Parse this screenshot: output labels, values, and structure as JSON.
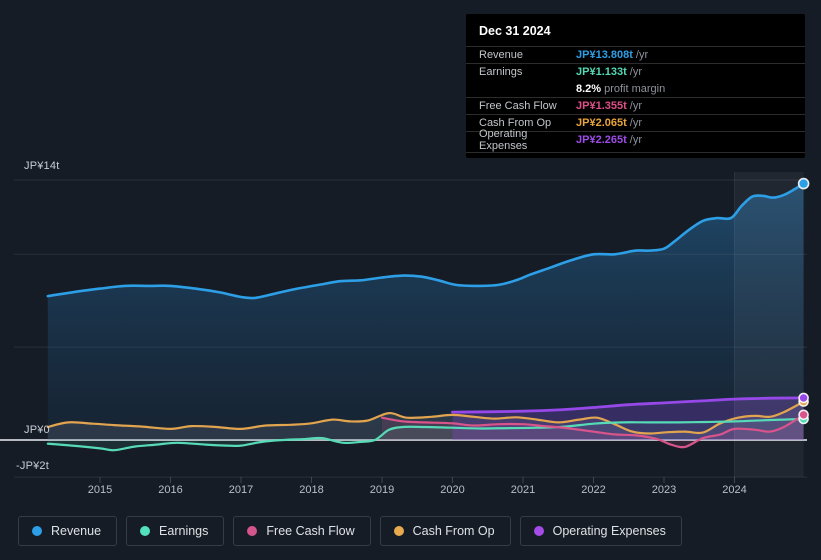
{
  "tooltip": {
    "title": "Dec 31 2024",
    "rows": [
      {
        "label": "Revenue",
        "value": "JP¥13.808t",
        "suffix": "/yr",
        "color": "#2d9fe6"
      },
      {
        "label": "Earnings",
        "value": "JP¥1.133t",
        "suffix": "/yr",
        "color": "#55d8b4",
        "margin_value": "8.2%",
        "margin_label": "profit margin"
      },
      {
        "label": "Free Cash Flow",
        "value": "JP¥1.355t",
        "suffix": "/yr",
        "color": "#dd5088"
      },
      {
        "label": "Cash From Op",
        "value": "JP¥2.065t",
        "suffix": "/yr",
        "color": "#e8a43d"
      },
      {
        "label": "Operating Expenses",
        "value": "JP¥2.265t",
        "suffix": "/yr",
        "color": "#9c4ce8"
      }
    ]
  },
  "legend": {
    "items": [
      {
        "label": "Revenue",
        "color": "#2d9fe6"
      },
      {
        "label": "Earnings",
        "color": "#52e0bd"
      },
      {
        "label": "Free Cash Flow",
        "color": "#d4548c"
      },
      {
        "label": "Cash From Op",
        "color": "#e8aa4e"
      },
      {
        "label": "Operating Expenses",
        "color": "#a44ce8"
      }
    ]
  },
  "chart_data": {
    "type": "line",
    "title": "Earnings and Revenue History",
    "unit": "JP¥ trillion per year",
    "x_axis": {
      "start": 2014.26,
      "end": 2024.98,
      "ticks": [
        2015,
        2016,
        2017,
        2018,
        2019,
        2020,
        2021,
        2022,
        2023,
        2024
      ]
    },
    "y_axis": {
      "gridline_values": [
        14,
        10,
        5,
        0,
        -2
      ],
      "ticks": [
        {
          "value": 14,
          "label": "JP¥14t"
        },
        {
          "value": 0,
          "label": "JP¥0"
        },
        {
          "value": -2,
          "label": "-JP¥2t"
        }
      ]
    },
    "highlight_band": {
      "from": 2024.0,
      "to": 2024.98
    },
    "series": [
      {
        "id": "revenue",
        "name": "Revenue",
        "color": "#2d9fe6",
        "fill": "gradient",
        "width": 2.6,
        "points": [
          [
            2014.26,
            7.75
          ],
          [
            2014.6,
            7.95
          ],
          [
            2015.0,
            8.15
          ],
          [
            2015.35,
            8.3
          ],
          [
            2015.7,
            8.3
          ],
          [
            2016.0,
            8.3
          ],
          [
            2016.35,
            8.15
          ],
          [
            2016.7,
            7.95
          ],
          [
            2017.0,
            7.7
          ],
          [
            2017.2,
            7.65
          ],
          [
            2017.5,
            7.9
          ],
          [
            2017.8,
            8.15
          ],
          [
            2018.1,
            8.35
          ],
          [
            2018.4,
            8.55
          ],
          [
            2018.7,
            8.6
          ],
          [
            2019.0,
            8.75
          ],
          [
            2019.3,
            8.85
          ],
          [
            2019.55,
            8.8
          ],
          [
            2019.8,
            8.6
          ],
          [
            2020.05,
            8.35
          ],
          [
            2020.35,
            8.3
          ],
          [
            2020.65,
            8.35
          ],
          [
            2020.9,
            8.6
          ],
          [
            2021.1,
            8.9
          ],
          [
            2021.4,
            9.3
          ],
          [
            2021.7,
            9.7
          ],
          [
            2022.0,
            10.0
          ],
          [
            2022.3,
            10.0
          ],
          [
            2022.6,
            10.2
          ],
          [
            2022.8,
            10.2
          ],
          [
            2023.0,
            10.3
          ],
          [
            2023.15,
            10.7
          ],
          [
            2023.35,
            11.3
          ],
          [
            2023.55,
            11.8
          ],
          [
            2023.75,
            11.95
          ],
          [
            2023.95,
            11.95
          ],
          [
            2024.1,
            12.6
          ],
          [
            2024.25,
            13.1
          ],
          [
            2024.4,
            13.15
          ],
          [
            2024.55,
            13.05
          ],
          [
            2024.7,
            13.2
          ],
          [
            2024.85,
            13.5
          ],
          [
            2024.98,
            13.808
          ]
        ]
      },
      {
        "id": "cash_from_op",
        "name": "Cash From Op",
        "color": "#e2a44e",
        "fill": "#b8c4cf",
        "fill_opacity": 0.13,
        "width": 2.2,
        "points": [
          [
            2014.26,
            0.7
          ],
          [
            2014.55,
            0.95
          ],
          [
            2014.9,
            0.88
          ],
          [
            2015.2,
            0.8
          ],
          [
            2015.6,
            0.72
          ],
          [
            2016.0,
            0.6
          ],
          [
            2016.3,
            0.75
          ],
          [
            2016.65,
            0.7
          ],
          [
            2017.0,
            0.6
          ],
          [
            2017.35,
            0.78
          ],
          [
            2017.7,
            0.82
          ],
          [
            2018.0,
            0.9
          ],
          [
            2018.3,
            1.1
          ],
          [
            2018.55,
            1.0
          ],
          [
            2018.8,
            1.05
          ],
          [
            2019.1,
            1.45
          ],
          [
            2019.35,
            1.2
          ],
          [
            2019.7,
            1.25
          ],
          [
            2020.0,
            1.35
          ],
          [
            2020.3,
            1.25
          ],
          [
            2020.6,
            1.15
          ],
          [
            2020.9,
            1.22
          ],
          [
            2021.2,
            1.1
          ],
          [
            2021.5,
            0.95
          ],
          [
            2021.8,
            1.1
          ],
          [
            2022.05,
            1.2
          ],
          [
            2022.3,
            0.85
          ],
          [
            2022.55,
            0.45
          ],
          [
            2022.8,
            0.35
          ],
          [
            2023.05,
            0.42
          ],
          [
            2023.3,
            0.45
          ],
          [
            2023.55,
            0.4
          ],
          [
            2023.8,
            0.9
          ],
          [
            2024.05,
            1.2
          ],
          [
            2024.3,
            1.3
          ],
          [
            2024.5,
            1.25
          ],
          [
            2024.7,
            1.5
          ],
          [
            2024.98,
            2.065
          ]
        ]
      },
      {
        "id": "earnings",
        "name": "Earnings",
        "color": "#57dbb7",
        "fill": "#57dbb7",
        "fill_opacity": 0.1,
        "width": 2.2,
        "points": [
          [
            2014.26,
            -0.2
          ],
          [
            2014.6,
            -0.3
          ],
          [
            2015.0,
            -0.45
          ],
          [
            2015.2,
            -0.55
          ],
          [
            2015.5,
            -0.35
          ],
          [
            2015.8,
            -0.25
          ],
          [
            2016.1,
            -0.15
          ],
          [
            2016.5,
            -0.25
          ],
          [
            2016.8,
            -0.3
          ],
          [
            2017.0,
            -0.3
          ],
          [
            2017.3,
            -0.1
          ],
          [
            2017.6,
            0.0
          ],
          [
            2017.9,
            0.05
          ],
          [
            2018.15,
            0.1
          ],
          [
            2018.45,
            -0.15
          ],
          [
            2018.7,
            -0.1
          ],
          [
            2018.9,
            0.0
          ],
          [
            2019.1,
            0.55
          ],
          [
            2019.3,
            0.7
          ],
          [
            2019.6,
            0.7
          ],
          [
            2020.0,
            0.66
          ],
          [
            2020.4,
            0.62
          ],
          [
            2020.8,
            0.64
          ],
          [
            2021.2,
            0.66
          ],
          [
            2021.6,
            0.72
          ],
          [
            2022.0,
            0.88
          ],
          [
            2022.4,
            0.95
          ],
          [
            2022.8,
            0.95
          ],
          [
            2023.2,
            0.95
          ],
          [
            2023.6,
            0.97
          ],
          [
            2024.0,
            1.0
          ],
          [
            2024.4,
            1.06
          ],
          [
            2024.7,
            1.1
          ],
          [
            2024.98,
            1.133
          ]
        ]
      },
      {
        "id": "free_cash_flow",
        "name": "Free Cash Flow",
        "color": "#d8548a",
        "fill": "#d8548a",
        "fill_opacity": 0.15,
        "width": 2.2,
        "points": [
          [
            2019.0,
            1.2
          ],
          [
            2019.3,
            1.0
          ],
          [
            2019.6,
            0.95
          ],
          [
            2020.0,
            0.9
          ],
          [
            2020.3,
            0.78
          ],
          [
            2020.65,
            0.85
          ],
          [
            2021.0,
            0.85
          ],
          [
            2021.3,
            0.75
          ],
          [
            2021.6,
            0.65
          ],
          [
            2022.0,
            0.45
          ],
          [
            2022.3,
            0.3
          ],
          [
            2022.6,
            0.25
          ],
          [
            2022.9,
            0.05
          ],
          [
            2023.1,
            -0.25
          ],
          [
            2023.3,
            -0.37
          ],
          [
            2023.55,
            0.1
          ],
          [
            2023.8,
            0.3
          ],
          [
            2024.0,
            0.6
          ],
          [
            2024.3,
            0.55
          ],
          [
            2024.5,
            0.45
          ],
          [
            2024.7,
            0.7
          ],
          [
            2024.98,
            1.355
          ]
        ]
      },
      {
        "id": "operating_expenses",
        "name": "Operating Expenses",
        "color": "#9648e8",
        "fill": "#8a46d8",
        "fill_opacity": 0.28,
        "width": 2.8,
        "points": [
          [
            2020.0,
            1.5
          ],
          [
            2020.5,
            1.52
          ],
          [
            2021.0,
            1.55
          ],
          [
            2021.5,
            1.62
          ],
          [
            2022.0,
            1.75
          ],
          [
            2022.5,
            1.9
          ],
          [
            2023.0,
            2.0
          ],
          [
            2023.5,
            2.1
          ],
          [
            2024.0,
            2.2
          ],
          [
            2024.5,
            2.25
          ],
          [
            2024.98,
            2.265
          ]
        ]
      }
    ]
  }
}
